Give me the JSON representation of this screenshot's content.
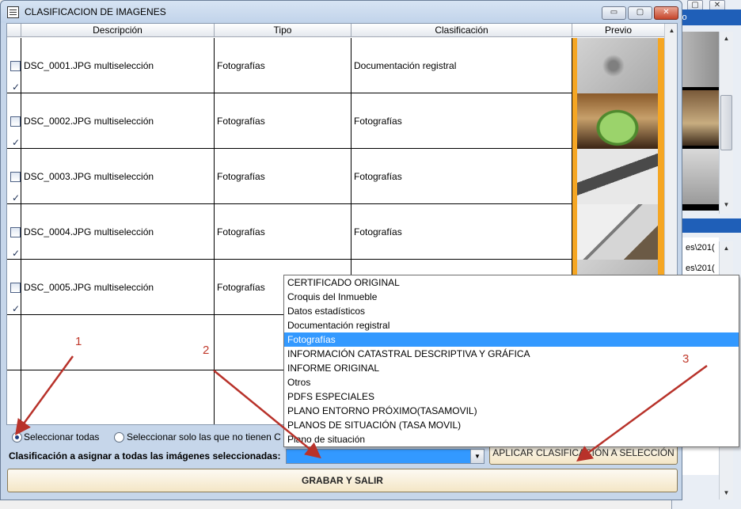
{
  "background": {
    "header_text": "vo",
    "list_rows": [
      "es\\201(",
      "es\\201("
    ]
  },
  "dialog": {
    "title": "CLASIFICACION DE IMAGENES",
    "window_buttons": {
      "minimize": "▭",
      "maximize": "▢",
      "close": "✕"
    }
  },
  "grid": {
    "columns": [
      "Descripción",
      "Tipo",
      "Clasificación",
      "Previo"
    ],
    "rows": [
      {
        "checked": true,
        "descripcion": "DSC_0001.JPG multiselección",
        "tipo": "Fotografías",
        "clasificacion": "Documentación registral",
        "preview": "grey-wall"
      },
      {
        "checked": true,
        "descripcion": "DSC_0002.JPG multiselección",
        "tipo": "Fotografías",
        "clasificacion": "Fotografías",
        "preview": "green-basin"
      },
      {
        "checked": true,
        "descripcion": "DSC_0003.JPG multiselección",
        "tipo": "Fotografías",
        "clasificacion": "Fotografías",
        "preview": "attic-window"
      },
      {
        "checked": true,
        "descripcion": "DSC_0004.JPG multiselección",
        "tipo": "Fotografías",
        "clasificacion": "Fotografías",
        "preview": "staircase"
      },
      {
        "checked": true,
        "descripcion": "DSC_0005.JPG multiselección",
        "tipo": "Fotografías",
        "clasificacion": "",
        "preview": "grey-wall"
      },
      {
        "checked": false,
        "descripcion": "",
        "tipo": "",
        "clasificacion": "",
        "preview": ""
      },
      {
        "checked": false,
        "descripcion": "",
        "tipo": "",
        "clasificacion": "",
        "preview": ""
      }
    ]
  },
  "controls": {
    "select_all_label": "Seleccionar todas",
    "select_unclassified_label": "Seleccionar solo las que no tienen C",
    "assign_label": "Clasificación a asignar a todas las imágenes seleccionadas:",
    "combo_value": "",
    "apply_button": "APLICAR CLASIFICACIÓN A SELECCIÓN",
    "save_button": "GRABAR Y SALIR"
  },
  "dropdown": {
    "options": [
      "CERTIFICADO ORIGINAL",
      "Croquis del Inmueble",
      "Datos estadísticos",
      "Documentación registral",
      "Fotografías",
      "INFORMACIÓN CATASTRAL DESCRIPTIVA Y GRÁFICA",
      "INFORME ORIGINAL",
      "Otros",
      "PDFS ESPECIALES",
      "PLANO ENTORNO PRÓXIMO(TASAMOVIL)",
      "PLANOS DE SITUACIÓN (TASA MOVIL)",
      "Plano de situación"
    ],
    "selected": "Fotografías"
  },
  "annotations": [
    "1",
    "2",
    "3"
  ],
  "colors": {
    "preview_border": "#f5a623",
    "selection": "#3399ff",
    "annotation": "#c0392b"
  }
}
